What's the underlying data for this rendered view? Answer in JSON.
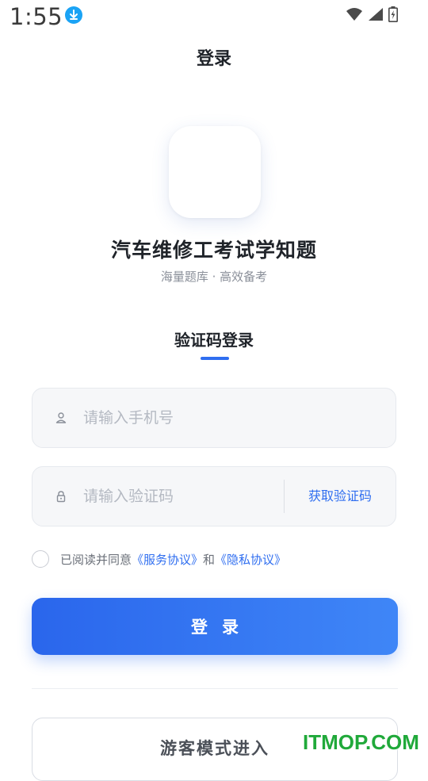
{
  "status_bar": {
    "time": "1:55",
    "icons": [
      "download-icon",
      "wifi-icon",
      "signal-icon",
      "battery-icon"
    ]
  },
  "nav": {
    "title": "登录"
  },
  "app": {
    "name": "汽车维修工考试学知题",
    "slogan": "海量题库 · 高效备考"
  },
  "login_tab": {
    "label": "验证码登录"
  },
  "phone_field": {
    "value": "",
    "placeholder": "请输入手机号",
    "icon": "user-icon"
  },
  "code_field": {
    "value": "",
    "placeholder": "请输入验证码",
    "icon": "lock-icon",
    "get_code_label": "获取验证码"
  },
  "agreement": {
    "checked": false,
    "prefix": "已阅读并同意",
    "service_link": "《服务协议》",
    "and": "和",
    "privacy_link": "《隐私协议》"
  },
  "login_button": {
    "label": "登录"
  },
  "guest_button": {
    "label": "游客模式进入"
  },
  "watermark": "ITMOP.COM",
  "colors": {
    "accent": "#2f6ef0",
    "watermark": "#20a93a"
  }
}
